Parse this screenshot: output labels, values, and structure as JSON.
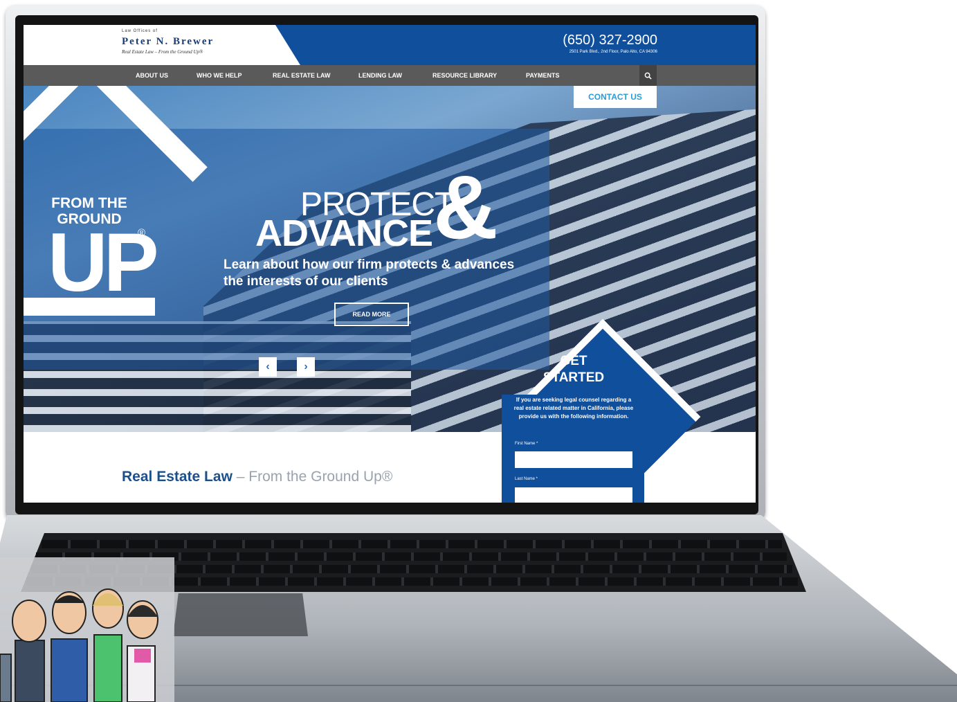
{
  "header": {
    "logo_small": "Law Offices of",
    "logo_name": "Peter N. Brewer",
    "logo_tagline": "Real Estate Law – From the Ground Up®",
    "phone": "(650) 327-2900",
    "address": "2501 Park Blvd., 2nd Floor, Palo Alto, CA 94306"
  },
  "nav": {
    "items": [
      "ABOUT US",
      "WHO WE HELP",
      "REAL ESTATE LAW",
      "LENDING LAW",
      "RESOURCE LIBRARY",
      "PAYMENTS"
    ],
    "search_icon": "search-icon"
  },
  "contact_button": "CONTACT US",
  "hero": {
    "badge_line1": "FROM THE",
    "badge_line2": "GROUND",
    "badge_big": "UP",
    "badge_reg": "®",
    "headline_top": "PROTECT",
    "headline_bottom": "ADVANCE",
    "headline_amp": "&",
    "description": "Learn about how our firm protects & advances the interests of our clients",
    "read_more": "READ MORE",
    "prev_icon": "chevron-left-icon",
    "next_icon": "chevron-right-icon",
    "prev_glyph": "‹",
    "next_glyph": "›"
  },
  "intro": {
    "strong": "Real Estate Law",
    "light": " – From the Ground Up®"
  },
  "get_started": {
    "title_line1": "GET",
    "title_line2": "STARTED",
    "description": "If you are seeking legal counsel regarding a real estate related matter in California, please provide us with the following information.",
    "first_name_label": "First Name *",
    "last_name_label": "Last Name *"
  },
  "colors": {
    "brand_blue": "#0f4f9c",
    "nav_gray": "#5a5a5a",
    "accent_cyan": "#2a9fd6"
  }
}
